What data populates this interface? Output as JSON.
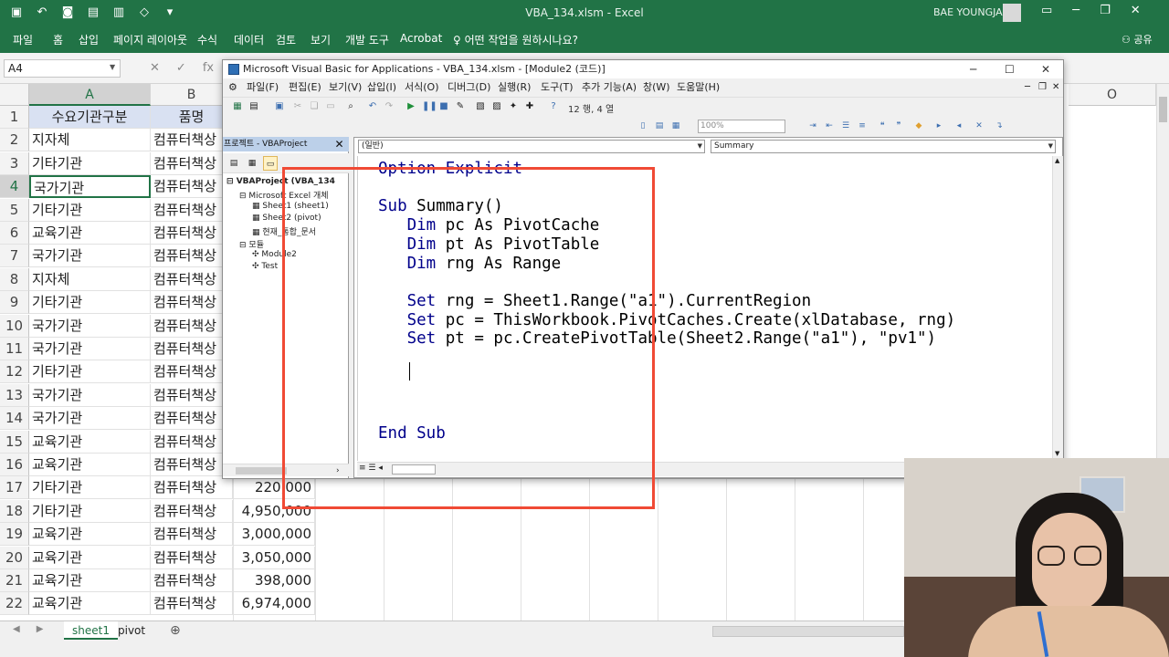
{
  "excel": {
    "window_title": "VBA_134.xlsm  -  Excel",
    "user_name": "BAE YOUNGJA",
    "ribbon_tabs": [
      "파일",
      "홈",
      "삽입",
      "페이지 레이아웃",
      "수식",
      "데이터",
      "검토",
      "보기",
      "개발 도구",
      "Acrobat"
    ],
    "tell_me": "어떤 작업을 원하시나요?",
    "share": "공유",
    "name_box": "A4",
    "columns": [
      "A",
      "B",
      "O"
    ],
    "rows": [
      {
        "n": "1",
        "a": "수요기관구분",
        "b": "품명",
        "c": ""
      },
      {
        "n": "2",
        "a": "지자체",
        "b": "컴퓨터책상",
        "c": ""
      },
      {
        "n": "3",
        "a": "기타기관",
        "b": "컴퓨터책상",
        "c": ""
      },
      {
        "n": "4",
        "a": "국가기관",
        "b": "컴퓨터책상",
        "c": ""
      },
      {
        "n": "5",
        "a": "기타기관",
        "b": "컴퓨터책상",
        "c": ""
      },
      {
        "n": "6",
        "a": "교육기관",
        "b": "컴퓨터책상",
        "c": ""
      },
      {
        "n": "7",
        "a": "국가기관",
        "b": "컴퓨터책상",
        "c": ""
      },
      {
        "n": "8",
        "a": "지자체",
        "b": "컴퓨터책상",
        "c": ""
      },
      {
        "n": "9",
        "a": "기타기관",
        "b": "컴퓨터책상",
        "c": ""
      },
      {
        "n": "10",
        "a": "국가기관",
        "b": "컴퓨터책상",
        "c": ""
      },
      {
        "n": "11",
        "a": "국가기관",
        "b": "컴퓨터책상",
        "c": ""
      },
      {
        "n": "12",
        "a": "기타기관",
        "b": "컴퓨터책상",
        "c": ""
      },
      {
        "n": "13",
        "a": "국가기관",
        "b": "컴퓨터책상",
        "c": ""
      },
      {
        "n": "14",
        "a": "국가기관",
        "b": "컴퓨터책상",
        "c": ""
      },
      {
        "n": "15",
        "a": "교육기관",
        "b": "컴퓨터책상",
        "c": ""
      },
      {
        "n": "16",
        "a": "교육기관",
        "b": "컴퓨터책상",
        "c": ""
      },
      {
        "n": "17",
        "a": "기타기관",
        "b": "컴퓨터책상",
        "c": "220,000"
      },
      {
        "n": "18",
        "a": "기타기관",
        "b": "컴퓨터책상",
        "c": "4,950,000"
      },
      {
        "n": "19",
        "a": "교육기관",
        "b": "컴퓨터책상",
        "c": "3,000,000"
      },
      {
        "n": "20",
        "a": "교육기관",
        "b": "컴퓨터책상",
        "c": "3,050,000"
      },
      {
        "n": "21",
        "a": "교육기관",
        "b": "컴퓨터책상",
        "c": "398,000"
      },
      {
        "n": "22",
        "a": "교육기관",
        "b": "컴퓨터책상",
        "c": "6,974,000"
      }
    ],
    "sheet_tabs": [
      "sheet1",
      "pivot"
    ]
  },
  "vbe": {
    "title": "Microsoft Visual Basic for Applications - VBA_134.xlsm - [Module2 (코드)]",
    "menu": [
      "파일(F)",
      "편집(E)",
      "보기(V)",
      "삽입(I)",
      "서식(O)",
      "디버그(D)",
      "실행(R)",
      "도구(T)",
      "추가 기능(A)",
      "창(W)",
      "도움말(H)"
    ],
    "cursor_pos": "12 행, 4 열",
    "zoom": "100%",
    "project_title": "프로젝트 - VBAProject",
    "tree": [
      {
        "label": "VBAProject (VBA_134",
        "indent": 0,
        "bold": true,
        "icon": "⊟"
      },
      {
        "label": "Microsoft Excel 개체",
        "indent": 1,
        "bold": false,
        "icon": "⊟"
      },
      {
        "label": "Sheet1 (sheet1)",
        "indent": 2,
        "bold": false,
        "icon": "▦"
      },
      {
        "label": "Sheet2 (pivot)",
        "indent": 2,
        "bold": false,
        "icon": "▦"
      },
      {
        "label": "현재_통합_문서",
        "indent": 2,
        "bold": false,
        "icon": "▦"
      },
      {
        "label": "모듈",
        "indent": 1,
        "bold": false,
        "icon": "⊟"
      },
      {
        "label": "Module2",
        "indent": 2,
        "bold": false,
        "icon": "✣"
      },
      {
        "label": "Test",
        "indent": 2,
        "bold": false,
        "icon": "✣"
      }
    ],
    "object_combo": "(일반)",
    "procedure_combo": "Summary",
    "code_lines": [
      {
        "kw": "Option Explicit",
        "rest": ""
      },
      {
        "kw": "",
        "rest": ""
      },
      {
        "kw": "Sub",
        "rest": " Summary()"
      },
      {
        "kw": "   Dim",
        "rest": " pc As PivotCache"
      },
      {
        "kw": "   Dim",
        "rest": " pt As PivotTable"
      },
      {
        "kw": "   Dim",
        "rest": " rng As Range"
      },
      {
        "kw": "",
        "rest": ""
      },
      {
        "kw": "   Set",
        "rest": " rng = Sheet1.Range(\"a1\").CurrentRegion"
      },
      {
        "kw": "   Set",
        "rest": " pc = ThisWorkbook.PivotCaches.Create(xlDatabase, rng)"
      },
      {
        "kw": "   Set",
        "rest": " pt = pc.CreatePivotTable(Sheet2.Range(\"a1\"), \"pv1\")"
      },
      {
        "kw": "",
        "rest": ""
      },
      {
        "kw": "",
        "rest": ""
      },
      {
        "kw": "",
        "rest": ""
      },
      {
        "kw": "",
        "rest": ""
      },
      {
        "kw": "End Sub",
        "rest": ""
      }
    ]
  },
  "colors": {
    "excel_green": "#217346",
    "code_keyword": "#00008b",
    "highlight": "#f04a35"
  }
}
